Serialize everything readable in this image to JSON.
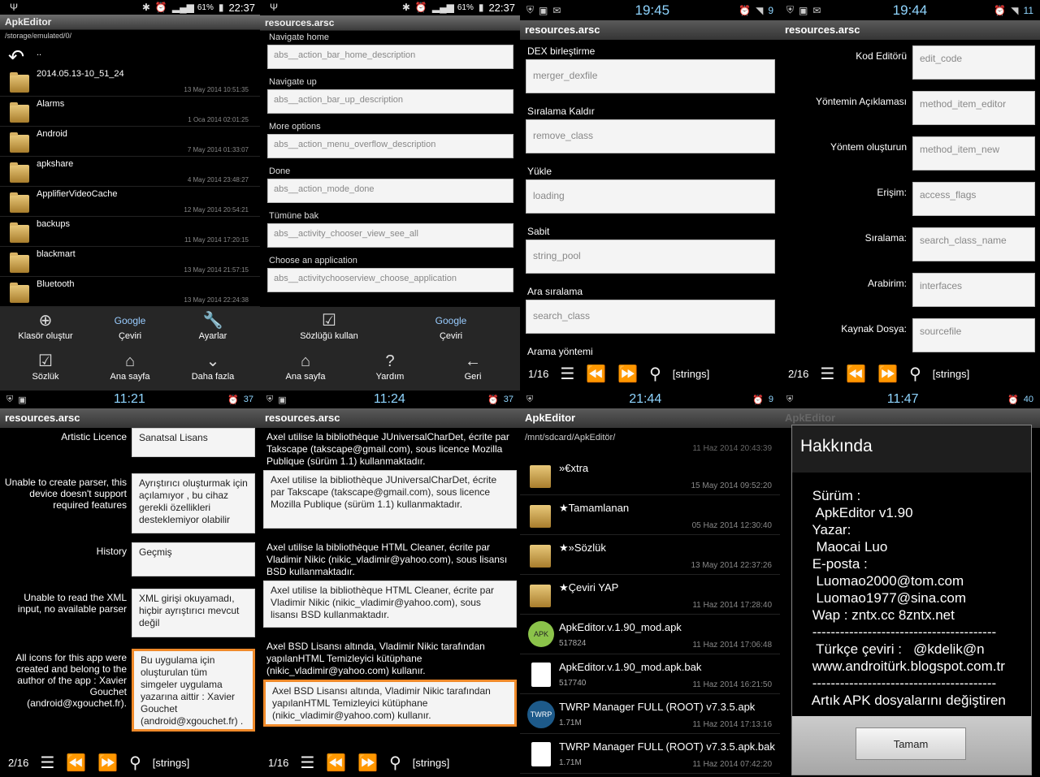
{
  "p1": {
    "status": {
      "battery": "61%",
      "time": "22:37"
    },
    "title": "ApkEditor",
    "path": "/storage/emulated/0/",
    "up": "..",
    "rows": [
      {
        "name": "2014.05.13-10_51_24",
        "date": "13 May 2014 10:51:35"
      },
      {
        "name": "Alarms",
        "date": "1 Oca 2014 02:01:25"
      },
      {
        "name": "Android",
        "date": "7 May 2014 01:33:07"
      },
      {
        "name": "apkshare",
        "date": "4 May 2014 23:48:27"
      },
      {
        "name": "ApplifierVideoCache",
        "date": "12 May 2014 20:54:21"
      },
      {
        "name": "backups",
        "date": "11 May 2014 17:20:15"
      },
      {
        "name": "blackmart",
        "date": "13 May 2014 21:57:15"
      },
      {
        "name": "Bluetooth",
        "date": "13 May 2014 22:24:38"
      }
    ],
    "menu": [
      "Klasör oluştur",
      "Çeviri",
      "Ayarlar",
      "Sözlük",
      "Ana sayfa",
      "Daha fazla"
    ],
    "bottom": {
      "time": "11:21",
      "num": "37"
    }
  },
  "p2": {
    "status": {
      "battery": "61%",
      "time": "22:37"
    },
    "title": "resources.arsc",
    "fields": [
      {
        "label": "Navigate home",
        "value": "abs__action_bar_home_description"
      },
      {
        "label": "Navigate up",
        "value": "abs__action_bar_up_description"
      },
      {
        "label": "More options",
        "value": "abs__action_menu_overflow_description"
      },
      {
        "label": "Done",
        "value": "abs__action_mode_done"
      },
      {
        "label": "Tümüne bak",
        "value": "abs__activity_chooser_view_see_all"
      },
      {
        "label": "Choose an application",
        "value": "abs__activitychooserview_choose_application"
      }
    ],
    "menu": [
      "Sözlüğü kullan",
      "Çeviri",
      "Ana sayfa",
      "Yardım",
      "Geri"
    ],
    "bottom": {
      "time": "11:24",
      "num": "37"
    }
  },
  "p3": {
    "status": {
      "time": "19:45",
      "num": "9"
    },
    "title": "resources.arsc",
    "fields": [
      {
        "label": "DEX birleştirme",
        "value": "merger_dexfile"
      },
      {
        "label": "Sıralama Kaldır",
        "value": "remove_class"
      },
      {
        "label": "Yükle",
        "value": "loading"
      },
      {
        "label": "Sabit",
        "value": "string_pool"
      },
      {
        "label": "Ara sıralama",
        "value": "search_class"
      },
      {
        "label": "Arama yöntemi",
        "value": ""
      }
    ],
    "nav": {
      "page": "1/16",
      "tag": "[strings]"
    },
    "bottom": {
      "time": "21:44",
      "num": "9"
    }
  },
  "p4": {
    "status": {
      "time": "19:44",
      "num": "11"
    },
    "title": "resources.arsc",
    "fields": [
      {
        "label": "Kod Editörü",
        "value": "edit_code"
      },
      {
        "label": "Yöntemin Açıklaması",
        "value": "method_item_editor"
      },
      {
        "label": "Yöntem oluşturun",
        "value": "method_item_new"
      },
      {
        "label": "Erişim:",
        "value": "access_flags"
      },
      {
        "label": "Sıralama:",
        "value": "search_class_name"
      },
      {
        "label": "Arabirim:",
        "value": "interfaces"
      },
      {
        "label": "Kaynak Dosya:",
        "value": "sourcefile"
      }
    ],
    "nav": {
      "page": "2/16",
      "tag": "[strings]"
    },
    "bottom": {
      "time": "11:47",
      "num": "40"
    }
  },
  "p5": {
    "title": "resources.arsc",
    "fields": [
      {
        "label": "Artistic Licence",
        "value": "Sanatsal Lisans"
      },
      {
        "label": "Unable to create parser, this device doesn't support required features",
        "value": "Ayrıştırıcı oluşturmak için açılamıyor , bu cihaz gerekli özellikleri desteklemiyor olabilir"
      },
      {
        "label": "History",
        "value": "Geçmiş"
      },
      {
        "label": "Unable to read the XML input, no available parser",
        "value": "XML girişi okuyamadı, hiçbir ayrıştırıcı mevcut değil"
      },
      {
        "label": "All icons for this app were created and belong to the author of the app : Xavier Gouchet (android@xgouchet.fr).",
        "value": "Bu uygulama için oluşturulan tüm simgeler uygulama yazarına aittir : Xavier Gouchet (android@xgouchet.fr) ."
      }
    ],
    "nav": {
      "page": "2/16",
      "tag": "[strings]"
    }
  },
  "p6": {
    "title": "resources.arsc",
    "fields": [
      {
        "label": "Axel utilise la bibliothèque JUniversalCharDet, écrite par Takscape (takscape@gmail.com), sous licence Mozilla Publique (sürüm 1.1) kullanmaktadır.",
        "value": "Axel utilise la bibliothèque JUniversalCharDet, écrite par Takscape (takscape@gmail.com), sous licence Mozilla Publique (sürüm 1.1) kullanmaktadır."
      },
      {
        "label": "Axel utilise la bibliothèque HTML Cleaner, écrite par Vladimir Nikic (nikic_vladimir@yahoo.com), sous lisansı BSD kullanmaktadır.",
        "value": "Axel utilise la bibliothèque HTML Cleaner, écrite par Vladimir Nikic (nikic_vladimir@yahoo.com), sous lisansı BSD kullanmaktadır."
      },
      {
        "label": "Axel BSD Lisansı altında, Vladimir Nikic tarafından yapılanHTML Temizleyici kütüphane (nikic_vladimir@yahoo.com) kullanır.",
        "value": "Axel BSD Lisansı altında, Vladimir Nikic tarafından yapılanHTML Temizleyici kütüphane (nikic_vladimir@yahoo.com) kullanır."
      }
    ],
    "nav": {
      "page": "1/16",
      "tag": "[strings]"
    }
  },
  "p7": {
    "title": "ApkEditor",
    "path": "/mnt/sdcard/ApkEditör/",
    "top_date": "11 Haz 2014 20:43:39",
    "rows": [
      {
        "name": "»€xtra",
        "size": "",
        "date": "15 May 2014 09:52:20",
        "kind": "folder"
      },
      {
        "name": "★Tamamlanan",
        "size": "",
        "date": "05 Haz 2014 12:30:40",
        "kind": "folder"
      },
      {
        "name": "★»Sözlük",
        "size": "",
        "date": "13 May 2014 22:37:26",
        "kind": "folder"
      },
      {
        "name": "★Çeviri YAP",
        "size": "",
        "date": "11 Haz 2014 17:28:40",
        "kind": "folder"
      },
      {
        "name": "ApkEditor.v.1.90_mod.apk",
        "size": "517824",
        "date": "11 Haz 2014 17:06:48",
        "kind": "apk"
      },
      {
        "name": "ApkEditor.v.1.90_mod.apk.bak",
        "size": "517740",
        "date": "11 Haz 2014 16:21:50",
        "kind": "doc"
      },
      {
        "name": "TWRP Manager FULL (ROOT) v7.3.5.apk",
        "size": "1.71M",
        "date": "11 Haz 2014 17:13:16",
        "kind": "twrp"
      },
      {
        "name": "TWRP Manager FULL (ROOT) v7.3.5.apk.bak",
        "size": "1.71M",
        "date": "11 Haz 2014 07:42:20",
        "kind": "doc"
      }
    ]
  },
  "p8": {
    "title": "ApkEditor",
    "dialog_title": "Hakkında",
    "body": " Sürüm :\n  ApkEditor v1.90\n Yazar:\n  Maocai Luo\n E-posta :\n  Luomao2000@tom.com\n  Luomao1977@sina.com\n Wap : zntx.cc 8zntx.net\n ----------------------------------------\n  Türkçe çeviri :   @kdelik@n\n www.androitürk.blogspot.com.tr\n ----------------------------------------\n Artık APK dosyalarını değiştiren",
    "ok": "Tamam"
  }
}
